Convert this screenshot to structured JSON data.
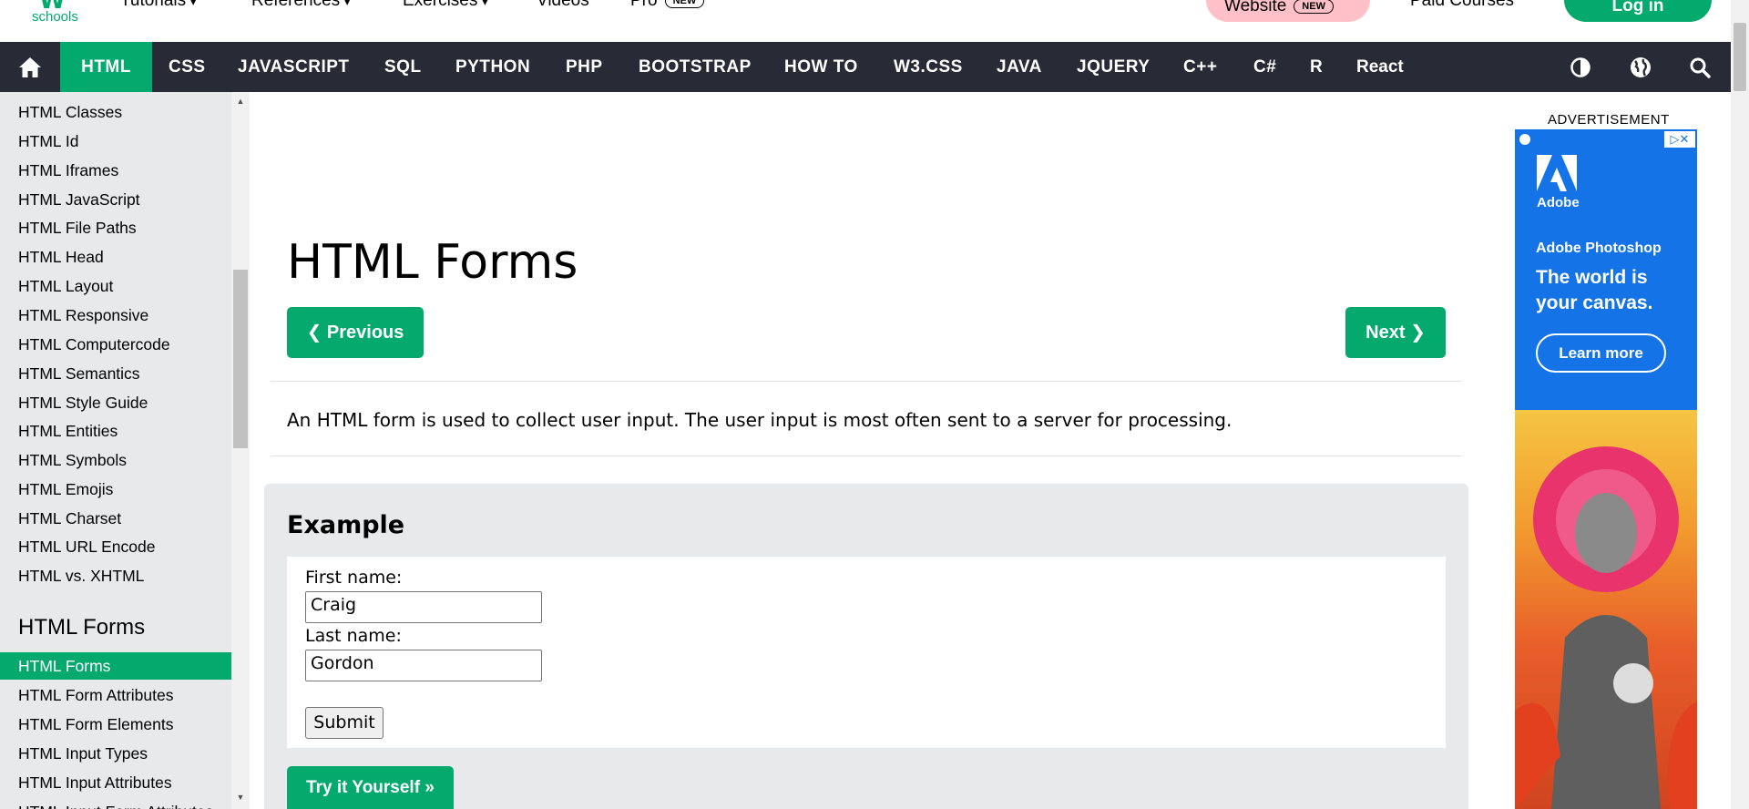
{
  "header": {
    "logo_text": "schools",
    "nav": [
      {
        "label": "Tutorials",
        "dropdown": true
      },
      {
        "label": "References",
        "dropdown": true
      },
      {
        "label": "Exercises",
        "dropdown": true
      },
      {
        "label": "Videos",
        "dropdown": false
      },
      {
        "label": "Pro",
        "badge": "NEW"
      }
    ],
    "website_label": "Website",
    "website_badge": "NEW",
    "paid_courses": "Paid Courses",
    "login": "Log in"
  },
  "mainnav": {
    "items": [
      "HTML",
      "CSS",
      "JAVASCRIPT",
      "SQL",
      "PYTHON",
      "PHP",
      "BOOTSTRAP",
      "HOW TO",
      "W3.CSS",
      "JAVA",
      "JQUERY",
      "C++",
      "C#",
      "R",
      "React"
    ],
    "active": "HTML",
    "icons": [
      "home-icon",
      "contrast-icon",
      "globe-icon",
      "search-icon"
    ]
  },
  "sidebar": {
    "items_top": [
      "HTML Classes",
      "HTML Id",
      "HTML Iframes",
      "HTML JavaScript",
      "HTML File Paths",
      "HTML Head",
      "HTML Layout",
      "HTML Responsive",
      "HTML Computercode",
      "HTML Semantics",
      "HTML Style Guide",
      "HTML Entities",
      "HTML Symbols",
      "HTML Emojis",
      "HTML Charset",
      "HTML URL Encode",
      "HTML vs. XHTML"
    ],
    "section_heading": "HTML Forms",
    "items_bottom": [
      "HTML Forms",
      "HTML Form Attributes",
      "HTML Form Elements",
      "HTML Input Types",
      "HTML Input Attributes",
      "HTML Input Form Attributes"
    ],
    "active": "HTML Forms"
  },
  "main": {
    "title": "HTML Forms",
    "prev_label": "❮ Previous",
    "next_label": "Next ❯",
    "intro": "An HTML form is used to collect user input. The user input is most often sent to a server for processing.",
    "example": {
      "heading": "Example",
      "first_name_label": "First name:",
      "first_name_value": "Craig",
      "last_name_label": "Last name:",
      "last_name_value": "Gordon",
      "submit_label": "Submit",
      "try_label": "Try it Yourself »"
    }
  },
  "ad": {
    "label": "ADVERTISEMENT",
    "brand": "Adobe",
    "product": "Adobe Photoshop",
    "slogan": "The world is your canvas.",
    "cta": "Learn more"
  },
  "colors": {
    "accent": "#04AA6D",
    "nav_bg": "#282A35",
    "sidebar_bg": "#E7E9EB",
    "ad_blue": "#1473E6",
    "website_pink": "#FFC0C7"
  }
}
